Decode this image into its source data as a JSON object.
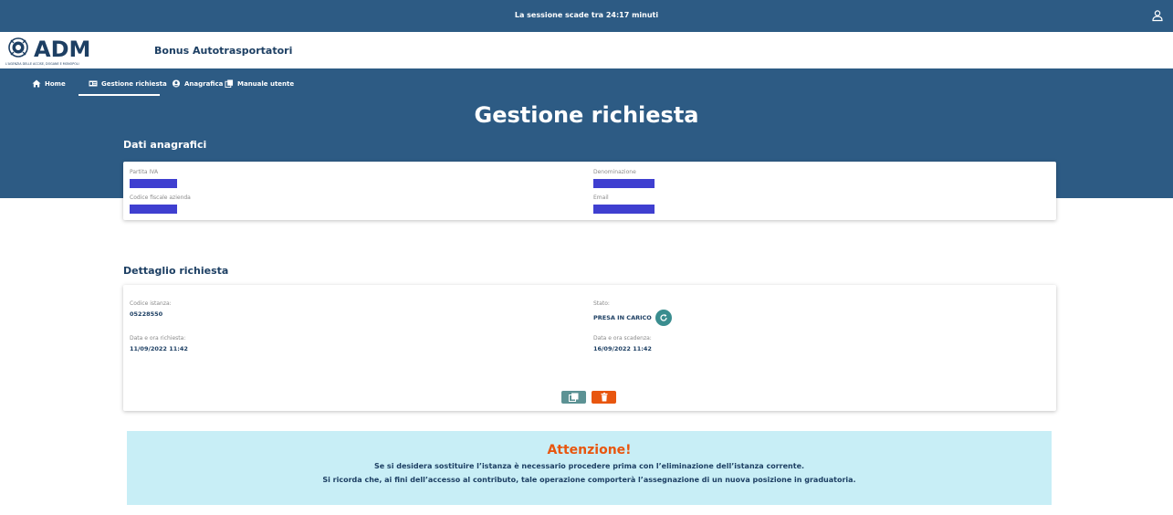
{
  "session": {
    "text": "La sessione scade tra 24:17 minuti"
  },
  "header": {
    "app_title": "Bonus Autotrasportatori",
    "logo_text": "ADM",
    "logo_subtitle": "L'AGENZIA DELLE ACCISE, DOGANE E MONOPOLI"
  },
  "nav": {
    "items": [
      {
        "label": "Home",
        "icon": "home-icon"
      },
      {
        "label": "Gestione richiesta",
        "icon": "id-card-icon",
        "active": true
      },
      {
        "label": "Anagrafica",
        "icon": "user-circle-icon"
      },
      {
        "label": "Manuale utente",
        "icon": "copy-icon"
      }
    ]
  },
  "page_title": "Gestione richiesta",
  "anagrafica": {
    "title": "Dati anagrafici",
    "partita_iva_label": "Partita IVA",
    "denominazione_label": "Denominazione",
    "codice_fiscale_label": "Codice fiscale azienda",
    "email_label": "Email"
  },
  "dettaglio": {
    "title": "Dettaglio richiesta",
    "codice_istanza_label": "Codice istanza:",
    "codice_istanza_value": "05228550",
    "stato_label": "Stato:",
    "stato_value": "PRESA IN CARICO",
    "data_richiesta_label": "Data e ora richiesta:",
    "data_richiesta_value": "11/09/2022 11:42",
    "data_scadenza_label": "Data e ora scadenza:",
    "data_scadenza_value": "16/09/2022 11:42"
  },
  "alert": {
    "title": "Attenzione!",
    "line1": "Se si desidera sostituire l’istanza è necessario procedere prima con l’eliminazione dell’istanza corrente.",
    "line2": "Si ricorda che, ai fini dell’accesso al contributo, tale operazione comporterà l’assegnazione di un nuova posizione in graduatoria."
  },
  "colors": {
    "primary": "#2d5b84",
    "accent": "#3a8d8f",
    "danger": "#e8560f",
    "alert_bg": "#c8eef6",
    "redaction": "#3f3fd0"
  }
}
